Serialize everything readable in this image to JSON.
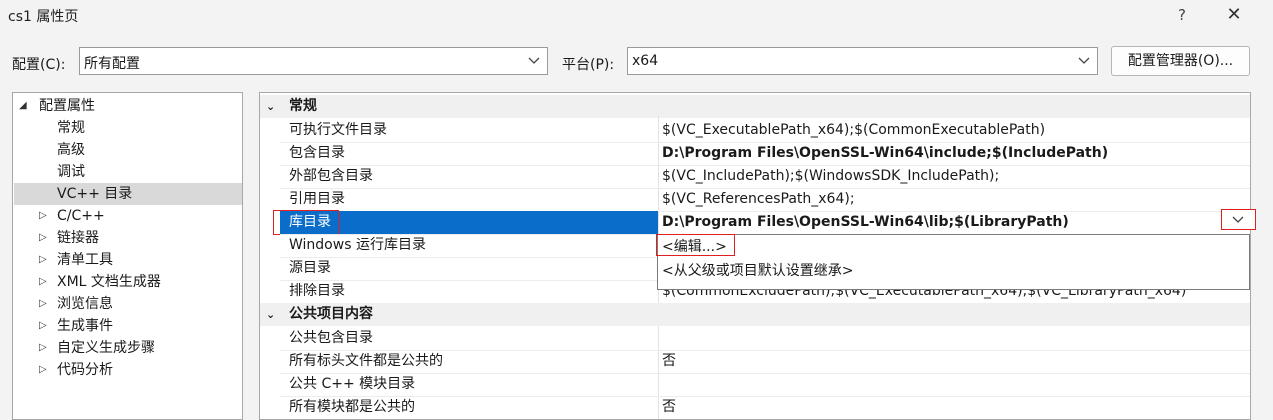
{
  "window": {
    "title": "cs1 属性页",
    "help": "?",
    "close": "✕"
  },
  "config_row": {
    "config_label": "配置(C):",
    "config_value": "所有配置",
    "platform_label": "平台(P):",
    "platform_value": "x64",
    "manager_button": "配置管理器(O)..."
  },
  "tree": {
    "root": "配置属性",
    "children": [
      "常规",
      "高级",
      "调试",
      "VC++ 目录"
    ],
    "selected": "VC++ 目录",
    "groups": [
      "C/C++",
      "链接器",
      "清单工具",
      "XML 文档生成器",
      "浏览信息",
      "生成事件",
      "自定义生成步骤",
      "代码分析"
    ]
  },
  "grid": {
    "category_general": "常规",
    "rows": [
      {
        "name": "可执行文件目录",
        "value": "$(VC_ExecutablePath_x64);$(CommonExecutablePath)"
      },
      {
        "name": "包含目录",
        "value": "D:\\Program Files\\OpenSSL-Win64\\include;$(IncludePath)"
      },
      {
        "name": "外部包含目录",
        "value": "$(VC_IncludePath);$(WindowsSDK_IncludePath);"
      },
      {
        "name": "引用目录",
        "value": "$(VC_ReferencesPath_x64);"
      },
      {
        "name": "库目录",
        "value": "D:\\Program Files\\OpenSSL-Win64\\lib;$(LibraryPath)"
      },
      {
        "name": "Windows 运行库目录",
        "value": ""
      },
      {
        "name": "源目录",
        "value": ""
      },
      {
        "name": "排除目录",
        "value": "$(CommonExcludePath);$(VC_ExecutablePath_x64);$(VC_LibraryPath_x64)"
      }
    ],
    "category_public": "公共项目内容",
    "public_rows": [
      {
        "name": "公共包含目录",
        "value": ""
      },
      {
        "name": "所有标头文件都是公共的",
        "value": "否"
      },
      {
        "name": "公共 C++ 模块目录",
        "value": ""
      },
      {
        "name": "所有模块都是公共的",
        "value": "否"
      }
    ]
  },
  "dropdown": {
    "items": [
      "<编辑...>",
      "<从父级或项目默认设置继承>"
    ]
  }
}
